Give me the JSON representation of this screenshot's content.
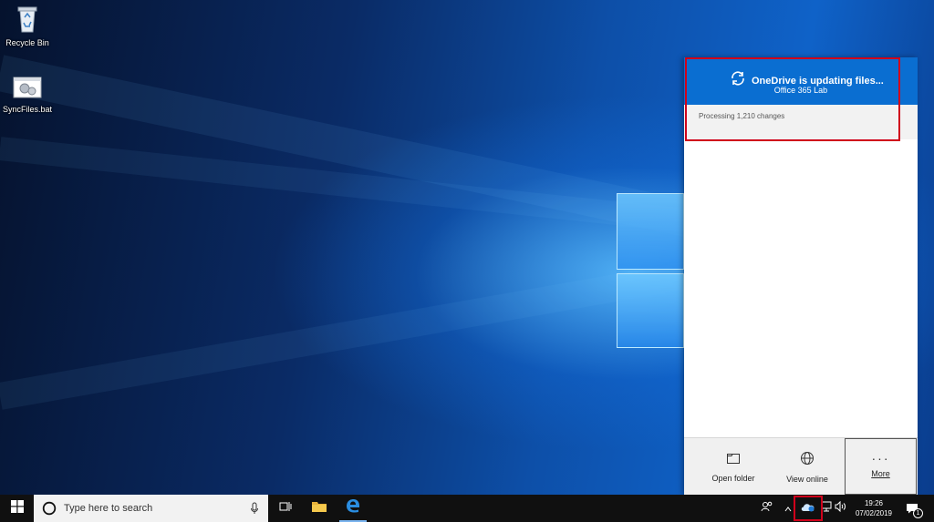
{
  "desktop": {
    "icons": [
      {
        "label": "Recycle Bin",
        "icon": "recycle-bin-icon"
      },
      {
        "label": "SyncFiles.bat",
        "icon": "batch-file-icon"
      }
    ]
  },
  "onedrive": {
    "title": "OneDrive is updating files...",
    "subtitle": "Office 365 Lab",
    "status": "Processing 1,210 changes",
    "footer": {
      "open_folder": "Open folder",
      "view_online": "View online",
      "more": "More"
    },
    "colors": {
      "header": "#0a6ed1",
      "highlight": "#d0021b"
    }
  },
  "taskbar": {
    "search_placeholder": "Type here to search",
    "time": "19:26",
    "date": "07/02/2019",
    "notification_count": "1"
  }
}
